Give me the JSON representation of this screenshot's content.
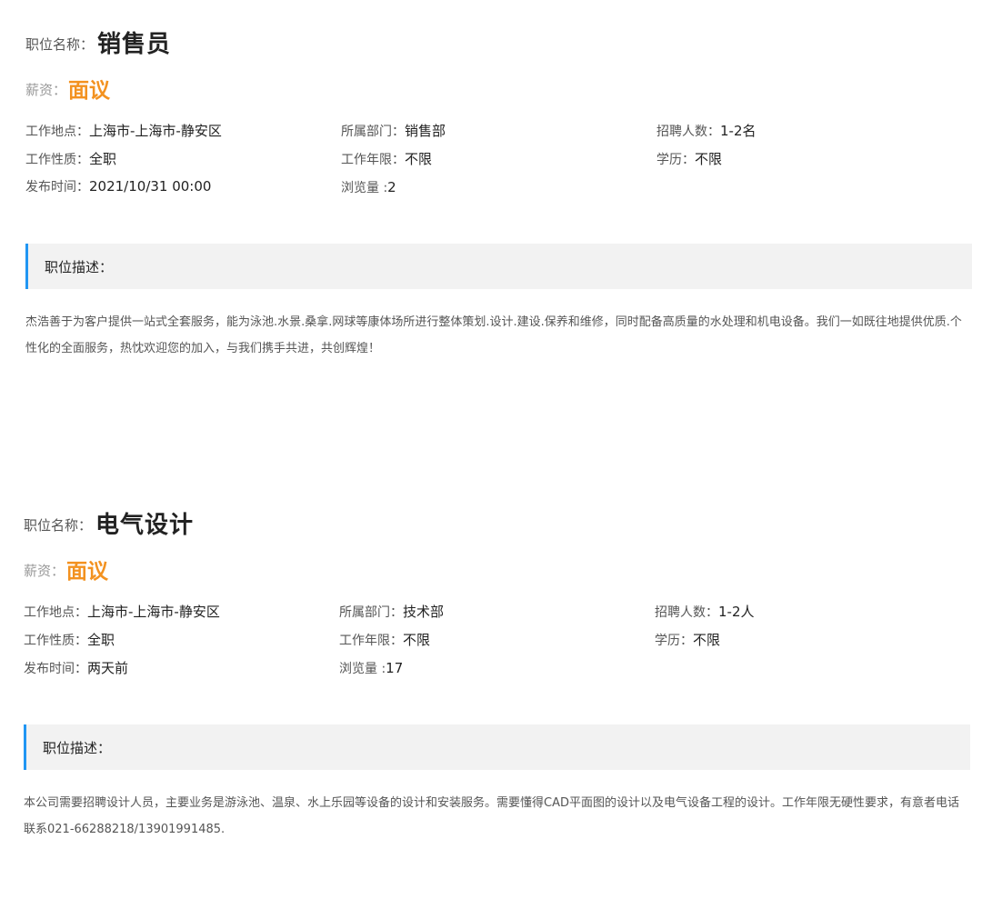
{
  "labels": {
    "title_label": "职位名称：",
    "salary_label": "薪资：",
    "location": "工作地点：",
    "department": "所属部门：",
    "headcount": "招聘人数：",
    "nature": "工作性质：",
    "experience": "工作年限：",
    "education": "学历：",
    "posted": "发布时间：",
    "views": "浏览量 :",
    "description_heading": "职位描述："
  },
  "jobs": [
    {
      "title": "销售员",
      "salary": "面议",
      "location": "上海市-上海市-静安区",
      "department": "销售部",
      "headcount": "1-2名",
      "nature": "全职",
      "experience": "不限",
      "education": "不限",
      "posted": "2021/10/31 00:00",
      "views": "2",
      "description": "杰浩善于为客户提供一站式全套服务，能为泳池.水景.桑拿.网球等康体场所进行整体策划.设计.建设.保养和维修，同时配备高质量的水处理和机电设备。我们一如既往地提供优质.个性化的全面服务，热忱欢迎您的加入，与我们携手共进，共创辉煌！"
    },
    {
      "title": "电气设计",
      "salary": "面议",
      "location": "上海市-上海市-静安区",
      "department": "技术部",
      "headcount": "1-2人",
      "nature": "全职",
      "experience": "不限",
      "education": "不限",
      "posted": "两天前",
      "views": "17",
      "description": "本公司需要招聘设计人员，主要业务是游泳池、温泉、水上乐园等设备的设计和安装服务。需要懂得CAD平面图的设计以及电气设备工程的设计。工作年限无硬性要求，有意者电话联系021-66288218/13901991485."
    }
  ],
  "colors": {
    "salary": "#f39220",
    "accent_bar": "#2196f3",
    "desc_bg": "#f2f2f2"
  }
}
